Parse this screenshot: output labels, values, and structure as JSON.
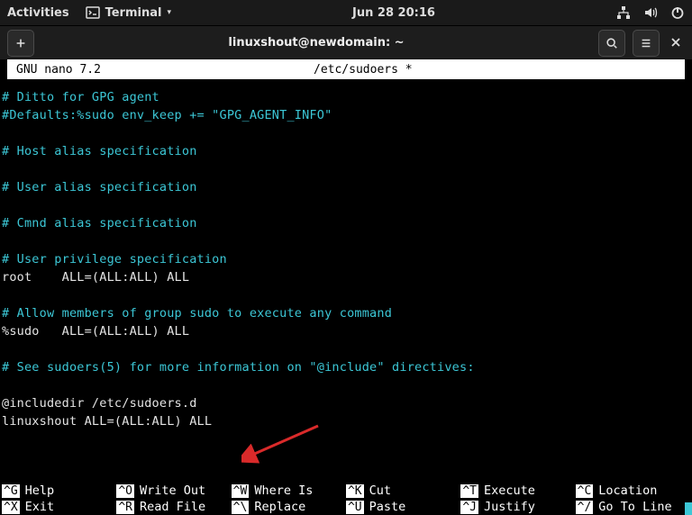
{
  "topbar": {
    "activities": "Activities",
    "app_name": "Terminal",
    "clock": "Jun 28  20:16"
  },
  "winbar": {
    "title": "linuxshout@newdomain: ~"
  },
  "nano": {
    "app": "GNU nano 7.2",
    "file": "/etc/sudoers *"
  },
  "lines": [
    {
      "cls": "cyan",
      "t": "# Ditto for GPG agent"
    },
    {
      "cls": "cyan",
      "t": "#Defaults:%sudo env_keep += \"GPG_AGENT_INFO\""
    },
    {
      "cls": "cyan",
      "t": ""
    },
    {
      "cls": "cyan",
      "t": "# Host alias specification"
    },
    {
      "cls": "cyan",
      "t": ""
    },
    {
      "cls": "cyan",
      "t": "# User alias specification"
    },
    {
      "cls": "cyan",
      "t": ""
    },
    {
      "cls": "cyan",
      "t": "# Cmnd alias specification"
    },
    {
      "cls": "cyan",
      "t": ""
    },
    {
      "cls": "cyan",
      "t": "# User privilege specification"
    },
    {
      "cls": "white",
      "t": "root    ALL=(ALL:ALL) ALL"
    },
    {
      "cls": "cyan",
      "t": ""
    },
    {
      "cls": "cyan",
      "t": "# Allow members of group sudo to execute any command"
    },
    {
      "cls": "white",
      "t": "%sudo   ALL=(ALL:ALL) ALL"
    },
    {
      "cls": "cyan",
      "t": ""
    },
    {
      "cls": "cyan",
      "t": "# See sudoers(5) for more information on \"@include\" directives:"
    },
    {
      "cls": "cyan",
      "t": ""
    },
    {
      "cls": "white",
      "t": "@includedir /etc/sudoers.d"
    },
    {
      "cls": "white",
      "t": "linuxshout ALL=(ALL:ALL) ALL"
    }
  ],
  "shortcuts": [
    [
      {
        "k": "^G",
        "l": "Help"
      },
      {
        "k": "^X",
        "l": "Exit"
      }
    ],
    [
      {
        "k": "^O",
        "l": "Write Out"
      },
      {
        "k": "^R",
        "l": "Read File"
      }
    ],
    [
      {
        "k": "^W",
        "l": "Where Is"
      },
      {
        "k": "^\\",
        "l": "Replace"
      }
    ],
    [
      {
        "k": "^K",
        "l": "Cut"
      },
      {
        "k": "^U",
        "l": "Paste"
      }
    ],
    [
      {
        "k": "^T",
        "l": "Execute"
      },
      {
        "k": "^J",
        "l": "Justify"
      }
    ],
    [
      {
        "k": "^C",
        "l": "Location"
      },
      {
        "k": "^/",
        "l": "Go To Line"
      }
    ]
  ]
}
